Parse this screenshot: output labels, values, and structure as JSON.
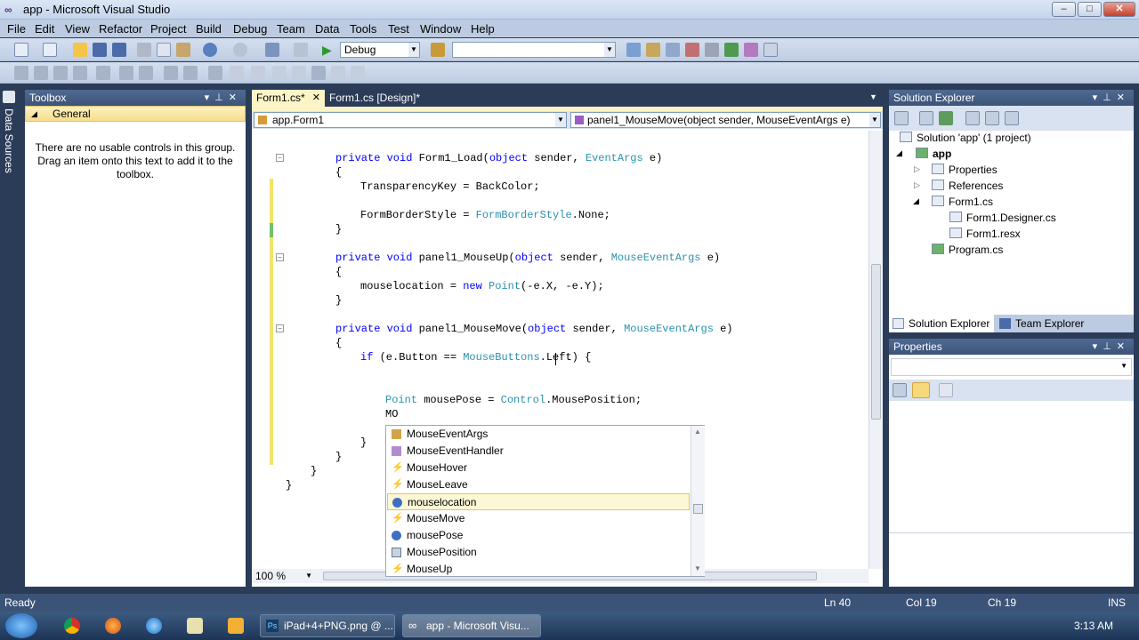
{
  "window": {
    "title": "app - Microsoft Visual Studio",
    "min": "–",
    "max": "□",
    "close": "✕"
  },
  "menu": [
    "File",
    "Edit",
    "View",
    "Refactor",
    "Project",
    "Build",
    "Debug",
    "Team",
    "Data",
    "Tools",
    "Test",
    "Window",
    "Help"
  ],
  "toolbar": {
    "config": "Debug",
    "platform": ""
  },
  "side_tab": {
    "label": "Data Sources"
  },
  "toolbox": {
    "title": "Toolbox",
    "group": "General",
    "empty_message": "There are no usable controls in this group. Drag an item onto this text to add it to the toolbox."
  },
  "editor": {
    "tabs": [
      "Form1.cs*",
      "Form1.cs [Design]*"
    ],
    "tab_close": "✕",
    "nav_class": "app.Form1",
    "nav_member": "panel1_MouseMove(object sender, MouseEventArgs e)",
    "zoom": "100 %",
    "code": {
      "l1": "private void Form1_Load(object sender, EventArgs e)",
      "l2": "{",
      "l3": "TransparencyKey = BackColor;",
      "l4": "FormBorderStyle = FormBorderStyle.None;",
      "l5": "}",
      "l6": "private void panel1_MouseUp(object sender, MouseEventArgs e)",
      "l7": "{",
      "l8": "mouselocation = new Point(-e.X, -e.Y);",
      "l9": "}",
      "l10": "private void panel1_MouseMove(object sender, MouseEventArgs e)",
      "l11": "{",
      "l12": "if (e.Button == MouseButtons.Left) {",
      "l13": "Point mousePose = Control.MousePosition;",
      "l14": "MO",
      "l15": "}",
      "l16": "}",
      "l17": "}",
      "l18": "}"
    }
  },
  "intellisense": {
    "items": [
      "MouseEventArgs",
      "MouseEventHandler",
      "MouseHover",
      "MouseLeave",
      "mouselocation",
      "MouseMove",
      "mousePose",
      "MousePosition",
      "MouseUp"
    ],
    "selected": "mouselocation"
  },
  "solution_explorer": {
    "title": "Solution Explorer",
    "solution": "Solution 'app' (1 project)",
    "project": "app",
    "properties": "Properties",
    "references": "References",
    "form": "Form1.cs",
    "designer": "Form1.Designer.cs",
    "resx": "Form1.resx",
    "program": "Program.cs",
    "tab_solution": "Solution Explorer",
    "tab_team": "Team Explorer"
  },
  "properties_panel": {
    "title": "Properties"
  },
  "status": {
    "ready": "Ready",
    "ln": "Ln 40",
    "col": "Col 19",
    "ch": "Ch 19",
    "mode": "INS"
  },
  "taskbar": {
    "task1": "iPad+4+PNG.png @ ...",
    "task2": "app - Microsoft Visu...",
    "time": "3:13 AM"
  },
  "colors": {
    "keyword": "#0000ff",
    "type": "#2b91af",
    "panel_header": "#4e6a92",
    "selection": "#fcf8d4"
  }
}
